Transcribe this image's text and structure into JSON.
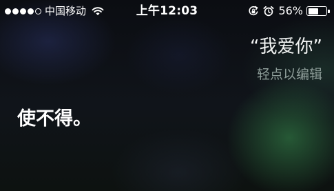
{
  "status_bar": {
    "signal_bars_filled": 4,
    "signal_bars_total": 5,
    "carrier": "中国移动",
    "wifi_icon": "wifi-icon",
    "time": "上午12:03",
    "rotation_lock_icon": "rotation-lock-icon",
    "alarm_icon": "alarm-clock-icon",
    "battery_percent": "56%",
    "battery_level": 0.56
  },
  "siri": {
    "query": "“我爱你”",
    "tap_to_edit": "轻点以编辑",
    "response": "使不得。"
  },
  "colors": {
    "text_primary": "#ffffff",
    "text_hint": "#8f9e9a",
    "glow_green": "#2e7040",
    "glow_blue": "#283060"
  }
}
